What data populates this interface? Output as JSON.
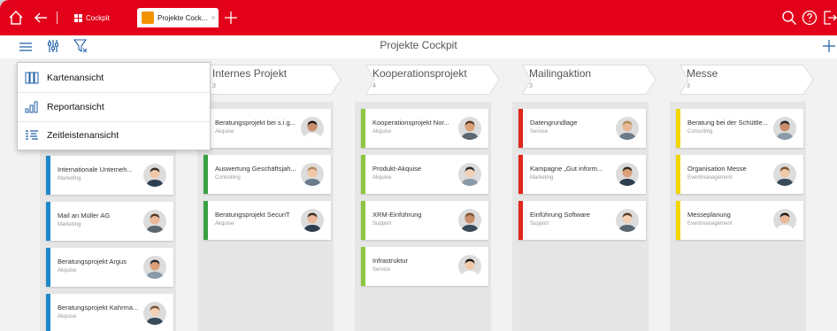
{
  "window": {
    "tab_cockpit": "Cockpit",
    "tab_active": "Projekte Cock...",
    "tab_close": "×"
  },
  "toolbar": {
    "title": "Projekte Cockpit"
  },
  "menu": {
    "items": [
      {
        "label": "Kartenansicht",
        "icon": "card-view-icon"
      },
      {
        "label": "Reportansicht",
        "icon": "bar-chart-icon"
      },
      {
        "label": "Zeitleistenansicht",
        "icon": "timeline-icon"
      }
    ]
  },
  "columns": [
    {
      "name": "",
      "count": "",
      "cards": [
        {
          "title": "Internationale Unterneh...",
          "sub": "Marketing",
          "color": "#1e88c9"
        },
        {
          "title": "Mail an Müller AG",
          "sub": "Marketing",
          "color": "#1e88c9"
        },
        {
          "title": "Beratungsprojekt Argus",
          "sub": "Akquise",
          "color": "#1e88c9"
        },
        {
          "title": "Beratungsprojekt Kahrma...",
          "sub": "Akquise",
          "color": "#1e88c9"
        }
      ]
    },
    {
      "name": "Internes Projekt",
      "count": "3",
      "cards": [
        {
          "title": "Beratungsprojekt bei s.i.g...",
          "sub": "Akquise",
          "color": "#3aa142"
        },
        {
          "title": "Auswertung Geschäftsjah...",
          "sub": "Controlling",
          "color": "#3aa142"
        },
        {
          "title": "Beratungsprojekt SecuriT",
          "sub": "Akquise",
          "color": "#3aa142"
        }
      ]
    },
    {
      "name": "Kooperationsprojekt",
      "count": "4",
      "cards": [
        {
          "title": "Kooperationsprojekt Nor...",
          "sub": "Akquise",
          "color": "#8dc63f"
        },
        {
          "title": "Produkt-Akquise",
          "sub": "Akquise",
          "color": "#8dc63f"
        },
        {
          "title": "XRM-Einführung",
          "sub": "Support",
          "color": "#8dc63f"
        },
        {
          "title": "Infrastruktur",
          "sub": "Service",
          "color": "#8dc63f"
        }
      ]
    },
    {
      "name": "Mailingaktion",
      "count": "3",
      "cards": [
        {
          "title": "Datengrundlage",
          "sub": "Service",
          "color": "#e2261c"
        },
        {
          "title": "Kampagne „Gut inform...",
          "sub": "Marketing",
          "color": "#e2261c"
        },
        {
          "title": "Einführung Software",
          "sub": "Support",
          "color": "#e2261c"
        }
      ]
    },
    {
      "name": "Messe",
      "count": "3",
      "cards": [
        {
          "title": "Beratung bei der Schüttle...",
          "sub": "Consulting",
          "color": "#f2d600"
        },
        {
          "title": "Organisation Messe",
          "sub": "Eventmanagement",
          "color": "#f2d600"
        },
        {
          "title": "Messeplanung",
          "sub": "Eventmanagement",
          "color": "#f2d600"
        }
      ]
    }
  ],
  "colors": {
    "brand": "#e2001a",
    "accent": "#1e5fa8"
  }
}
